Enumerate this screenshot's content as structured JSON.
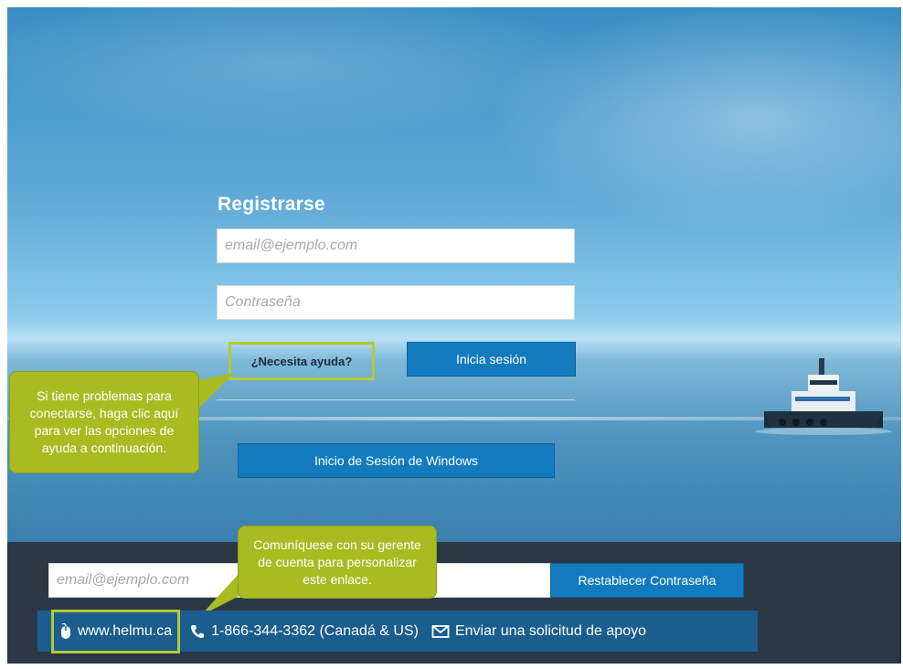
{
  "login": {
    "title": "Registrarse",
    "email_placeholder": "email@ejemplo.com",
    "password_placeholder": "Contraseña",
    "help_link": "¿Necesita ayuda?",
    "login_button": "Inicia sesión",
    "windows_button": "Inicio de Sesión de Windows"
  },
  "callouts": {
    "help": "Si tiene problemas para conectarse, haga clic aquí para ver las opciones de ayuda a continuación.",
    "account": "Comuníquese con su gerente de cuenta para personalizar este enlace."
  },
  "reset": {
    "email_placeholder": "email@ejemplo.com",
    "button": "Restablecer Contraseña"
  },
  "links": {
    "website": "www.helmu.ca",
    "phone": "1-866-344-3362 (Canadá & US)",
    "support": "Enviar una solicitud de apoyo"
  },
  "colors": {
    "accent_blue": "#137bbd",
    "callout_green": "#a8bc22",
    "footer_bg": "#2a3846",
    "links_bar": "#1a5d8e"
  },
  "icons": {
    "website": "mouse-icon",
    "phone": "phone-icon",
    "support": "envelope-icon"
  }
}
